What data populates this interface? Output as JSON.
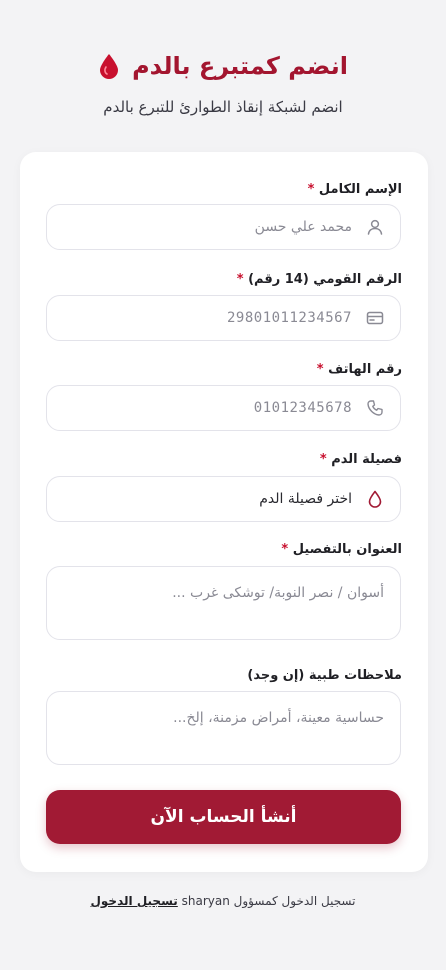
{
  "header": {
    "title": "انضم كمتبرع بالدم",
    "subtitle": "انضم لشبكة إنقاذ الطوارئ للتبرع بالدم"
  },
  "form": {
    "full_name": {
      "label": "الإسم الكامل",
      "required": "*",
      "placeholder": "محمد علي حسن",
      "icon": "user-icon"
    },
    "national_id": {
      "label": "الرقم القومي (14 رقم)",
      "required": "*",
      "placeholder": "29801011234567",
      "icon": "id-card-icon"
    },
    "phone": {
      "label": "رقم الهاتف",
      "required": "*",
      "placeholder": "01012345678",
      "icon": "phone-icon"
    },
    "blood_type": {
      "label": "فصيلة الدم",
      "required": "*",
      "value": "اختر فصيلة الدم",
      "icon": "blood-drop-icon"
    },
    "address": {
      "label": "العنوان بالتفصيل",
      "required": "*",
      "placeholder": "أسوان / نصر النوبة/ توشكى غرب ..."
    },
    "notes": {
      "label": "ملاحظات طبية (إن وجد)",
      "placeholder": "حساسية معينة، أمراض مزمنة، إلخ..."
    },
    "submit_label": "أنشأ الحساب الآن"
  },
  "footer": {
    "text": "تسجيل الدخول كمسؤول sharyan",
    "login_link": "تسجيل الدخول"
  },
  "colors": {
    "accent": "#a11a34",
    "title": "#a3152f",
    "required": "#c8102e"
  }
}
